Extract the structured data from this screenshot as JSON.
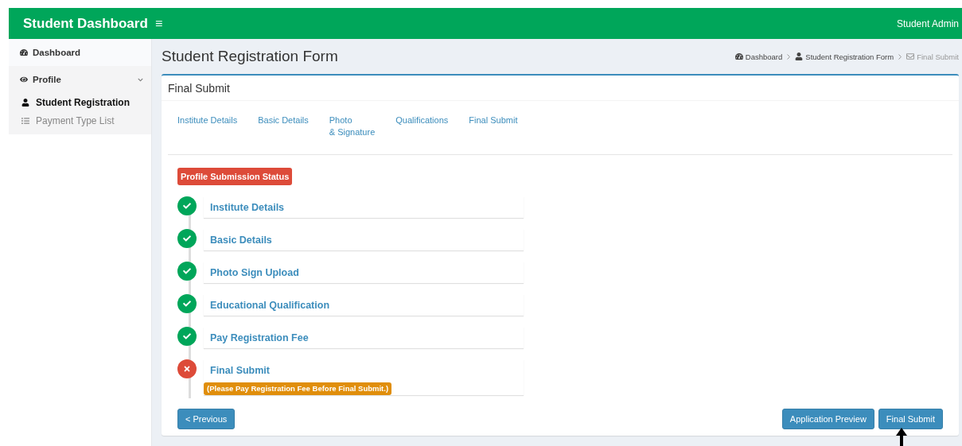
{
  "header": {
    "brand": "Student Dashboard",
    "menu_icon": "≡",
    "user": "Student Admin"
  },
  "sidebar": {
    "items": [
      {
        "label": "Dashboard",
        "expanded": false,
        "selected": false
      },
      {
        "label": "Profile",
        "expanded": true,
        "selected": false,
        "children": [
          {
            "label": "Student Registration",
            "selected": true
          },
          {
            "label": "Payment Type List",
            "selected": false
          }
        ]
      }
    ]
  },
  "page": {
    "title": "Student Registration Form",
    "breadcrumb": [
      {
        "label": "Dashboard",
        "active": false
      },
      {
        "label": "Student Registration Form",
        "active": false
      },
      {
        "label": "Final Submit",
        "active": true
      }
    ]
  },
  "box": {
    "title": "Final Submit",
    "tabs": [
      "Institute Details",
      "Basic Details",
      "Photo\n& Signature",
      "Qualifications",
      "Final Submit"
    ],
    "status_label": "Profile Submission Status",
    "steps": [
      {
        "label": "Institute Details",
        "done": true
      },
      {
        "label": "Basic Details",
        "done": true
      },
      {
        "label": "Photo Sign Upload",
        "done": true
      },
      {
        "label": "Educational Qualification",
        "done": true
      },
      {
        "label": "Pay Registration Fee",
        "done": true
      },
      {
        "label": "Final Submit",
        "done": false,
        "note": "(Please Pay Registration Fee Before Final Submit.)"
      }
    ],
    "previous_button": "< Previous",
    "preview_button": "Application Preview",
    "submit_button": "Final Submit"
  }
}
